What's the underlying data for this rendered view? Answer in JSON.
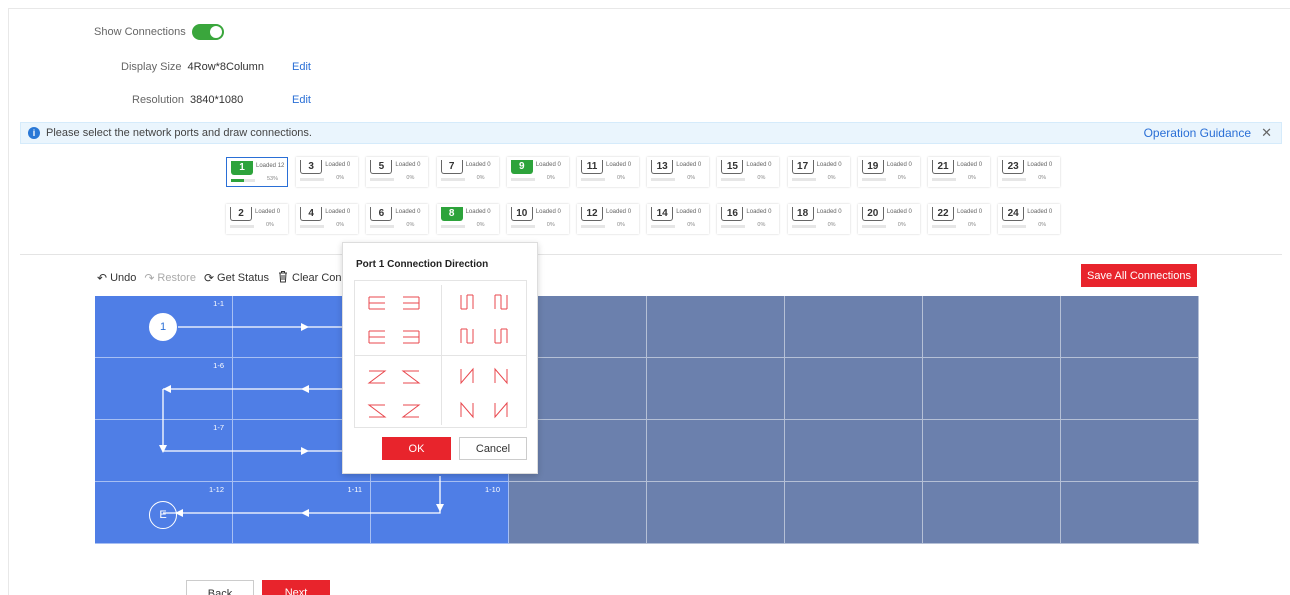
{
  "settings": {
    "show_connections_label": "Show Connections",
    "show_connections_on": true,
    "display_size_label": "Display Size",
    "display_size_value": "4Row*8Column",
    "resolution_label": "Resolution",
    "resolution_value": "3840*1080",
    "edit_label": "Edit"
  },
  "banner": {
    "icon": "info-icon",
    "message": "Please select the network ports and draw connections.",
    "guidance_link": "Operation Guidance",
    "close_glyph": "✕"
  },
  "ports": {
    "top_row": [
      {
        "num": "1",
        "loaded": "Loaded 12",
        "pct": "53%",
        "fill": 0.53,
        "active": true,
        "selected": true
      },
      {
        "num": "3",
        "loaded": "Loaded 0",
        "pct": "0%",
        "fill": 0,
        "active": false
      },
      {
        "num": "5",
        "loaded": "Loaded 0",
        "pct": "0%",
        "fill": 0,
        "active": false
      },
      {
        "num": "7",
        "loaded": "Loaded 0",
        "pct": "0%",
        "fill": 0,
        "active": false
      },
      {
        "num": "9",
        "loaded": "Loaded 0",
        "pct": "0%",
        "fill": 0,
        "active": true
      },
      {
        "num": "11",
        "loaded": "Loaded 0",
        "pct": "0%",
        "fill": 0,
        "active": false
      },
      {
        "num": "13",
        "loaded": "Loaded 0",
        "pct": "0%",
        "fill": 0,
        "active": false
      },
      {
        "num": "15",
        "loaded": "Loaded 0",
        "pct": "0%",
        "fill": 0,
        "active": false
      },
      {
        "num": "17",
        "loaded": "Loaded 0",
        "pct": "0%",
        "fill": 0,
        "active": false
      },
      {
        "num": "19",
        "loaded": "Loaded 0",
        "pct": "0%",
        "fill": 0,
        "active": false
      },
      {
        "num": "21",
        "loaded": "Loaded 0",
        "pct": "0%",
        "fill": 0,
        "active": false
      },
      {
        "num": "23",
        "loaded": "Loaded 0",
        "pct": "0%",
        "fill": 0,
        "active": false
      }
    ],
    "bottom_row": [
      {
        "num": "2",
        "loaded": "Loaded 0",
        "pct": "0%",
        "fill": 0,
        "active": false
      },
      {
        "num": "4",
        "loaded": "Loaded 0",
        "pct": "0%",
        "fill": 0,
        "active": false
      },
      {
        "num": "6",
        "loaded": "Loaded 0",
        "pct": "0%",
        "fill": 0,
        "active": false
      },
      {
        "num": "8",
        "loaded": "Loaded 0",
        "pct": "0%",
        "fill": 0,
        "active": true
      },
      {
        "num": "10",
        "loaded": "Loaded 0",
        "pct": "0%",
        "fill": 0,
        "active": false
      },
      {
        "num": "12",
        "loaded": "Loaded 0",
        "pct": "0%",
        "fill": 0,
        "active": false
      },
      {
        "num": "14",
        "loaded": "Loaded 0",
        "pct": "0%",
        "fill": 0,
        "active": false
      },
      {
        "num": "16",
        "loaded": "Loaded 0",
        "pct": "0%",
        "fill": 0,
        "active": false
      },
      {
        "num": "18",
        "loaded": "Loaded 0",
        "pct": "0%",
        "fill": 0,
        "active": false
      },
      {
        "num": "20",
        "loaded": "Loaded 0",
        "pct": "0%",
        "fill": 0,
        "active": false
      },
      {
        "num": "22",
        "loaded": "Loaded 0",
        "pct": "0%",
        "fill": 0,
        "active": false
      },
      {
        "num": "24",
        "loaded": "Loaded 0",
        "pct": "0%",
        "fill": 0,
        "active": false
      }
    ]
  },
  "toolbar": {
    "undo": "Undo",
    "undo_icon": "undo-icon",
    "restore": "Restore",
    "restore_icon": "redo-icon",
    "get_status": "Get Status",
    "get_status_icon": "refresh-icon",
    "clear": "Clear Conne",
    "clear_icon": "trash-icon",
    "save_all": "Save All Connections"
  },
  "grid": {
    "rows": 4,
    "columns": 8,
    "active_color": "#4f7ee6",
    "inactive_color": "#6b80ad",
    "cell_labels": [
      {
        "row": 0,
        "col": 0,
        "text": "1-1"
      },
      {
        "row": 1,
        "col": 0,
        "text": "1-6"
      },
      {
        "row": 2,
        "col": 0,
        "text": "1-7"
      },
      {
        "row": 3,
        "col": 0,
        "text": "1-12"
      },
      {
        "row": 3,
        "col": 1,
        "text": "1-11"
      },
      {
        "row": 3,
        "col": 2,
        "text": "1-10"
      }
    ],
    "start_marker": "1",
    "end_marker": "E"
  },
  "popup": {
    "title": "Port 1 Connection Direction",
    "ok": "OK",
    "cancel": "Cancel",
    "direction_icons": [
      "row-snake-right-icon",
      "row-snake-left-icon",
      "col-snake-down-icon",
      "col-snake-down-alt-icon",
      "row-snake-up-right-icon",
      "row-snake-up-left-icon",
      "col-snake-up-icon",
      "col-snake-up-alt-icon",
      "z-right-icon",
      "z-left-icon",
      "n-down-icon",
      "n-down-alt-icon",
      "z-up-right-icon",
      "z-up-left-icon",
      "n-up-icon",
      "n-up-alt-icon"
    ]
  },
  "footer": {
    "back": "Back",
    "next": "Next"
  },
  "colors": {
    "accent_red": "#e8242c",
    "link_blue": "#2a6fd6",
    "success_green": "#2da33b"
  }
}
